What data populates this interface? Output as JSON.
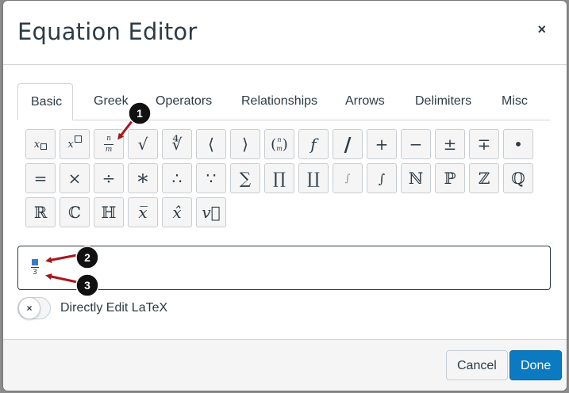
{
  "dialog": {
    "title": "Equation Editor",
    "close_label": "×"
  },
  "tabs": [
    {
      "label": "Basic",
      "active": true
    },
    {
      "label": "Greek"
    },
    {
      "label": "Operators"
    },
    {
      "label": "Relationships"
    },
    {
      "label": "Arrows"
    },
    {
      "label": "Delimiters"
    },
    {
      "label": "Misc"
    }
  ],
  "symbols": {
    "row1": [
      "x□ subscript",
      "x□ superscript",
      "n/m fraction",
      "√",
      "ⁿ√",
      "⟨",
      "⟩",
      "(n m)",
      "f",
      "/",
      "+",
      "−",
      "±",
      "∓",
      "•"
    ],
    "row1_glyphs": {
      "sqrt": "√",
      "nroot": "∜",
      "langle": "⟨",
      "rangle": "⟩",
      "func": "f",
      "slash": "/",
      "plus": "+",
      "minus": "−",
      "pm": "±",
      "mp": "∓",
      "bullet": "•"
    },
    "row2_glyphs": {
      "equals": "=",
      "times": "×",
      "divide": "÷",
      "ast": "∗",
      "therefore": "∴",
      "because": "∵",
      "sum": "∑",
      "prod": "∏",
      "coprod": "∐",
      "int_limits": "∫",
      "int": "∫",
      "naturals": "ℕ",
      "primes": "ℙ",
      "integers": "ℤ",
      "rationals": "ℚ"
    },
    "row3_glyphs": {
      "reals": "ℝ",
      "complex": "ℂ",
      "quaternions": "ℍ",
      "overline": "x̅",
      "hat": "x̂",
      "vec": "v⃗"
    },
    "frac_num": "n",
    "frac_den": "m",
    "binom_top": "n",
    "binom_bottom": "m",
    "sub_var": "x",
    "sup_var": "x"
  },
  "math_field": {
    "denominator": "3"
  },
  "latex_toggle": {
    "icon": "×",
    "label": "Directly Edit LaTeX"
  },
  "footer": {
    "cancel_label": "Cancel",
    "done_label": "Done"
  },
  "callouts": [
    {
      "number": "1"
    },
    {
      "number": "2"
    },
    {
      "number": "3"
    }
  ],
  "colors": {
    "primary": "#0b7ac0",
    "callout_arrow": "#a8171c",
    "badge": "#111111",
    "placeholder_fill": "#3a7ac8"
  }
}
